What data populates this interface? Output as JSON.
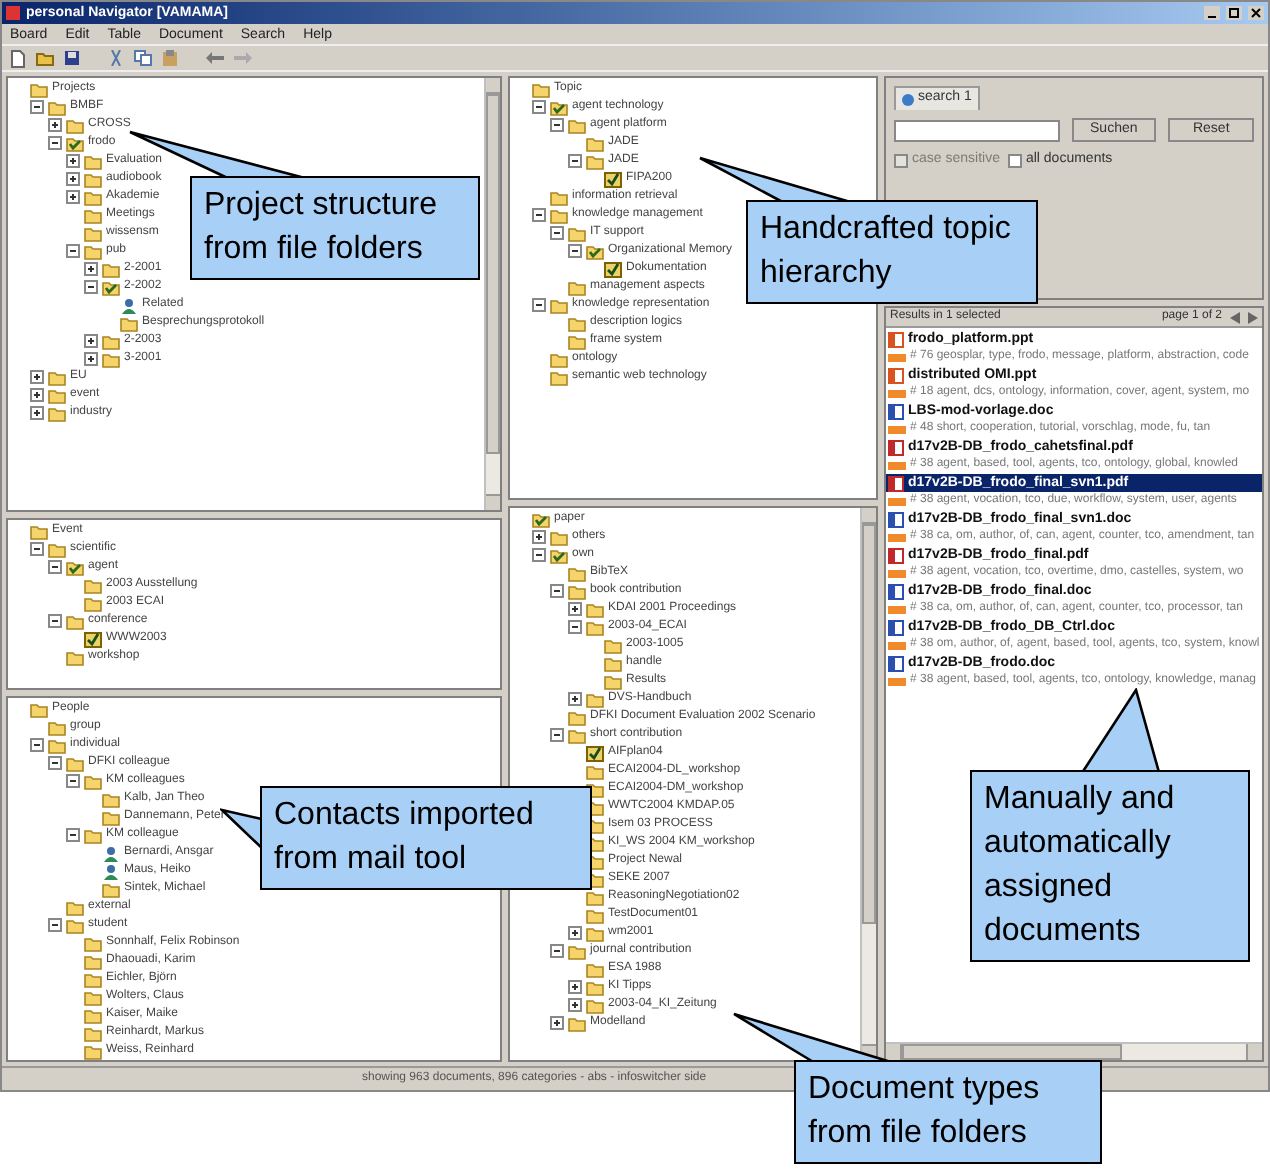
{
  "window": {
    "title": "personal Navigator [VAMAMA]"
  },
  "menu": [
    "Board",
    "Edit",
    "Table",
    "Document",
    "Search",
    "Help"
  ],
  "panes": {
    "projects": {
      "kind": "folder",
      "label": "Projects",
      "children": [
        {
          "label": "BMBF",
          "kind": "folder",
          "expanded": true,
          "children": [
            {
              "label": "CROSS",
              "kind": "folder",
              "expanded": false
            },
            {
              "label": "frodo",
              "kind": "agent",
              "expanded": true,
              "children": [
                {
                  "label": "Evaluation",
                  "kind": "folder",
                  "expanded": false
                },
                {
                  "label": "audiobook",
                  "kind": "folder",
                  "expanded": false
                },
                {
                  "label": "Akademie",
                  "kind": "folder",
                  "expanded": false
                },
                {
                  "label": "Meetings",
                  "kind": "folder"
                },
                {
                  "label": "wissensm",
                  "kind": "folder"
                },
                {
                  "label": "pub",
                  "kind": "folder",
                  "expanded": true,
                  "children": [
                    {
                      "label": "2-2001",
                      "kind": "folder",
                      "expanded": false
                    },
                    {
                      "label": "2-2002",
                      "kind": "agent",
                      "expanded": true,
                      "children": [
                        {
                          "label": "Related",
                          "kind": "person"
                        },
                        {
                          "label": "Besprechungsprotokoll",
                          "kind": "folder"
                        }
                      ]
                    },
                    {
                      "label": "2-2003",
                      "kind": "folder",
                      "expanded": false
                    },
                    {
                      "label": "3-2001",
                      "kind": "folder",
                      "expanded": false
                    }
                  ]
                }
              ]
            }
          ]
        },
        {
          "label": "EU",
          "kind": "folder",
          "expanded": false
        },
        {
          "label": "event",
          "kind": "folder",
          "expanded": false
        },
        {
          "label": "industry",
          "kind": "folder",
          "expanded": false
        }
      ]
    },
    "events": {
      "kind": "folder",
      "label": "Event",
      "children": [
        {
          "label": "scientific",
          "kind": "folder",
          "expanded": true,
          "children": [
            {
              "label": "agent",
              "kind": "agent",
              "expanded": true,
              "children": [
                {
                  "label": "2003 Ausstellung",
                  "kind": "folder"
                },
                {
                  "label": "2003 ECAI",
                  "kind": "folder"
                }
              ]
            },
            {
              "label": "conference",
              "kind": "folder",
              "expanded": true,
              "children": [
                {
                  "label": "WWW2003",
                  "kind": "checked"
                }
              ]
            },
            {
              "label": "workshop",
              "kind": "folder"
            }
          ]
        }
      ]
    },
    "people": {
      "kind": "folder",
      "label": "People",
      "children": [
        {
          "label": "group",
          "kind": "folder"
        },
        {
          "label": "individual",
          "kind": "folder",
          "expanded": true,
          "children": [
            {
              "label": "DFKI colleague",
              "kind": "folder",
              "expanded": true,
              "children": [
                {
                  "label": "KM colleagues",
                  "kind": "folder",
                  "expanded": true,
                  "children": [
                    {
                      "label": "Kalb, Jan Theo",
                      "kind": "folder"
                    },
                    {
                      "label": "Dannemann, Peter",
                      "kind": "folder"
                    }
                  ]
                },
                {
                  "label": "KM colleague",
                  "kind": "folder",
                  "expanded": true,
                  "children": [
                    {
                      "label": "Bernardi, Ansgar",
                      "kind": "person"
                    },
                    {
                      "label": "Maus, Heiko",
                      "kind": "person"
                    },
                    {
                      "label": "Sintek, Michael",
                      "kind": "folder"
                    }
                  ]
                }
              ]
            },
            {
              "label": "external",
              "kind": "folder"
            },
            {
              "label": "student",
              "kind": "folder",
              "expanded": true,
              "children": [
                {
                  "label": "Sonnhalf, Felix Robinson",
                  "kind": "folder"
                },
                {
                  "label": "Dhaouadi, Karim",
                  "kind": "folder"
                },
                {
                  "label": "Eichler, Björn",
                  "kind": "folder"
                },
                {
                  "label": "Wolters, Claus",
                  "kind": "folder"
                },
                {
                  "label": "Kaiser, Maike",
                  "kind": "folder"
                },
                {
                  "label": "Reinhardt, Markus",
                  "kind": "folder"
                },
                {
                  "label": "Weiss, Reinhard",
                  "kind": "folder"
                }
              ]
            }
          ]
        }
      ]
    },
    "topics": {
      "kind": "folder",
      "label": "Topic",
      "children": [
        {
          "label": "agent technology",
          "kind": "agent",
          "expanded": true,
          "children": [
            {
              "label": "agent platform",
              "kind": "folder",
              "expanded": true,
              "children": [
                {
                  "label": "JADE",
                  "kind": "folder"
                },
                {
                  "label": "JADE",
                  "kind": "folder",
                  "expanded": true,
                  "children": [
                    {
                      "label": "FIPA200",
                      "kind": "checked"
                    }
                  ]
                }
              ]
            }
          ]
        },
        {
          "label": "information retrieval",
          "kind": "folder"
        },
        {
          "label": "knowledge management",
          "kind": "folder",
          "expanded": true,
          "children": [
            {
              "label": "IT support",
              "kind": "folder",
              "expanded": true,
              "children": [
                {
                  "label": "Organizational Memory",
                  "kind": "agent",
                  "expanded": true,
                  "children": [
                    {
                      "label": "Dokumentation",
                      "kind": "checked"
                    }
                  ]
                }
              ]
            },
            {
              "label": "management aspects",
              "kind": "folder"
            }
          ]
        },
        {
          "label": "knowledge representation",
          "kind": "folder",
          "expanded": true,
          "children": [
            {
              "label": "description logics",
              "kind": "folder"
            },
            {
              "label": "frame system",
              "kind": "folder"
            }
          ]
        },
        {
          "label": "ontology",
          "kind": "folder"
        },
        {
          "label": "semantic web technology",
          "kind": "folder"
        }
      ]
    },
    "papers": {
      "kind": "agent",
      "label": "paper",
      "children": [
        {
          "label": "others",
          "kind": "folder",
          "expanded": false
        },
        {
          "label": "own",
          "kind": "agent",
          "expanded": true,
          "children": [
            {
              "label": "BibTeX",
              "kind": "folder"
            },
            {
              "label": "book contribution",
              "kind": "folder",
              "expanded": true,
              "children": [
                {
                  "label": "KDAI 2001 Proceedings",
                  "kind": "folder",
                  "expanded": false
                },
                {
                  "label": "2003-04_ECAI",
                  "kind": "folder",
                  "expanded": true,
                  "children": [
                    {
                      "label": "2003-1005",
                      "kind": "folder"
                    },
                    {
                      "label": "handle",
                      "kind": "folder"
                    },
                    {
                      "label": "Results",
                      "kind": "folder"
                    }
                  ]
                },
                {
                  "label": "DVS-Handbuch",
                  "kind": "folder",
                  "expanded": false
                }
              ]
            },
            {
              "label": "DFKI Document Evaluation 2002 Scenario",
              "kind": "folder"
            },
            {
              "label": "short contribution",
              "kind": "folder",
              "expanded": true,
              "children": [
                {
                  "label": "AIFplan04",
                  "kind": "checked"
                },
                {
                  "label": "ECAI2004-DL_workshop",
                  "kind": "folder"
                },
                {
                  "label": "ECAI2004-DM_workshop",
                  "kind": "folder"
                },
                {
                  "label": "WWTC2004 KMDAP.05",
                  "kind": "folder"
                },
                {
                  "label": "Isem 03 PROCESS",
                  "kind": "folder"
                },
                {
                  "label": "KI_WS 2004 KM_workshop",
                  "kind": "folder"
                },
                {
                  "label": "Project Newal",
                  "kind": "folder"
                },
                {
                  "label": "SEKE 2007",
                  "kind": "folder"
                },
                {
                  "label": "ReasoningNegotiation02",
                  "kind": "folder"
                },
                {
                  "label": "TestDocument01",
                  "kind": "folder"
                },
                {
                  "label": "wm2001",
                  "kind": "folder",
                  "expanded": false
                }
              ]
            },
            {
              "label": "journal contribution",
              "kind": "folder",
              "expanded": true,
              "children": [
                {
                  "label": "ESA 1988",
                  "kind": "folder"
                },
                {
                  "label": "KI Tipps",
                  "kind": "folder",
                  "expanded": false
                },
                {
                  "label": "2003-04_KI_Zeitung",
                  "kind": "folder",
                  "expanded": false
                }
              ]
            },
            {
              "label": "Modelland",
              "kind": "folder",
              "expanded": false
            }
          ]
        }
      ]
    }
  },
  "search": {
    "tab": "search 1",
    "buttons": [
      "Suchen",
      "Reset"
    ],
    "options": [
      {
        "label": "case sensitive",
        "checked": false,
        "disabled": true
      },
      {
        "label": "all documents",
        "checked": false,
        "disabled": false
      }
    ]
  },
  "results": {
    "summary": "Results in 1 selected",
    "page": "page 1 of 2",
    "documents": [
      {
        "title": "frodo_platform.ppt",
        "kind": "ppt",
        "keywords": "# 76 geosplar, type, frodo, message, platform, abstraction, code",
        "selected": false
      },
      {
        "title": "distributed OMI.ppt",
        "kind": "ppt",
        "keywords": "# 18 agent, dcs, ontology, information, cover, agent, system, mo",
        "selected": false
      },
      {
        "title": "LBS-mod-vorlage.doc",
        "kind": "doc",
        "keywords": "# 48 short, cooperation, tutorial, vorschlag, mode, fu, tan",
        "selected": false
      },
      {
        "title": "d17v2B-DB_frodo_cahetsfinal.pdf",
        "kind": "pdf",
        "keywords": "# 38 agent, based, tool, agents, tco, ontology, global, knowled",
        "selected": false
      },
      {
        "title": "d17v2B-DB_frodo_final_svn1.pdf",
        "kind": "pdf",
        "keywords": "# 38 agent, vocation, tco, due, workflow, system, user, agents",
        "selected": true
      },
      {
        "title": "d17v2B-DB_frodo_final_svn1.doc",
        "kind": "doc",
        "keywords": "# 38 ca, om, author, of, can, agent, counter, tco, amendment, tan",
        "selected": false
      },
      {
        "title": "d17v2B-DB_frodo_final.pdf",
        "kind": "pdf",
        "keywords": "# 38 agent, vocation, tco, overtime, dmo, castelles, system, wo",
        "selected": false
      },
      {
        "title": "d17v2B-DB_frodo_final.doc",
        "kind": "doc",
        "keywords": "# 38 ca, om, author, of, can, agent, counter, tco, processor, tan",
        "selected": false
      },
      {
        "title": "d17v2B-DB_frodo_DB_Ctrl.doc",
        "kind": "doc",
        "keywords": "# 38 om, author, of, agent, based, tool, agents, tco, system, knowl",
        "selected": false
      },
      {
        "title": "d17v2B-DB_frodo.doc",
        "kind": "doc",
        "keywords": "# 38 agent, based, tool, agents, tco, ontology, knowledge, manag",
        "selected": false
      }
    ]
  },
  "status_bar": "showing 963 documents, 896 categories - abs - infoswitcher side",
  "callouts": [
    "Project structure from file folders",
    "Handcrafted topic hierarchy",
    "Contacts imported from mail tool",
    "Manually and automatically assigned documents",
    "Document types from file folders"
  ]
}
